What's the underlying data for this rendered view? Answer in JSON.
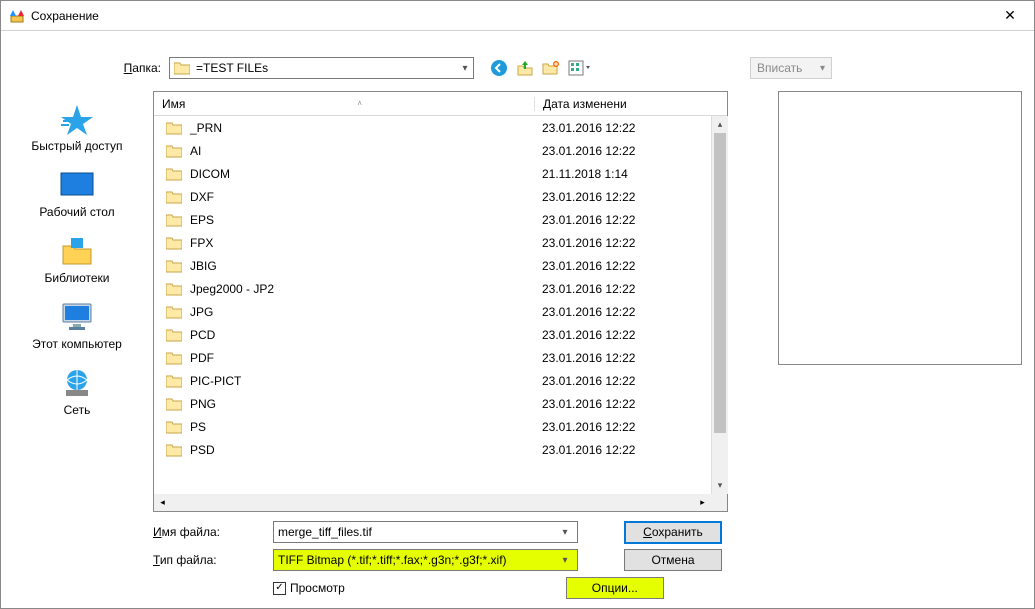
{
  "window": {
    "title": "Сохранение"
  },
  "papka": {
    "label_prefix": "П",
    "label_rest": "апка:",
    "value": "=TEST FILEs"
  },
  "vpisat": {
    "label": "Вписать"
  },
  "places": [
    {
      "label": "Быстрый доступ"
    },
    {
      "label": "Рабочий стол"
    },
    {
      "label": "Библиотеки"
    },
    {
      "label": "Этот компьютер"
    },
    {
      "label": "Сеть"
    }
  ],
  "columns": {
    "name": "Имя",
    "date": "Дата изменени"
  },
  "files": [
    {
      "name": "_PRN",
      "date": "23.01.2016 12:22"
    },
    {
      "name": "AI",
      "date": "23.01.2016 12:22"
    },
    {
      "name": "DICOM",
      "date": "21.11.2018 1:14"
    },
    {
      "name": "DXF",
      "date": "23.01.2016 12:22"
    },
    {
      "name": "EPS",
      "date": "23.01.2016 12:22"
    },
    {
      "name": "FPX",
      "date": "23.01.2016 12:22"
    },
    {
      "name": "JBIG",
      "date": "23.01.2016 12:22"
    },
    {
      "name": "Jpeg2000 - JP2",
      "date": "23.01.2016 12:22"
    },
    {
      "name": "JPG",
      "date": "23.01.2016 12:22"
    },
    {
      "name": "PCD",
      "date": "23.01.2016 12:22"
    },
    {
      "name": "PDF",
      "date": "23.01.2016 12:22"
    },
    {
      "name": "PIC-PICT",
      "date": "23.01.2016 12:22"
    },
    {
      "name": "PNG",
      "date": "23.01.2016 12:22"
    },
    {
      "name": "PS",
      "date": "23.01.2016 12:22"
    },
    {
      "name": "PSD",
      "date": "23.01.2016 12:22"
    }
  ],
  "filename": {
    "label_prefix": "И",
    "label_rest": "мя файла:",
    "value": "merge_tiff_files.tif"
  },
  "filetype": {
    "label_prefix": "Т",
    "label_rest": "ип файла:",
    "value": "TIFF Bitmap (*.tif;*.tiff;*.fax;*.g3n;*.g3f;*.xif)"
  },
  "preview_chk": {
    "label_prefix": "П",
    "label_rest": "росмотр",
    "checked": true
  },
  "buttons": {
    "save_prefix": "С",
    "save_rest": "охранить",
    "cancel": "Отмена",
    "options": "Опции..."
  }
}
